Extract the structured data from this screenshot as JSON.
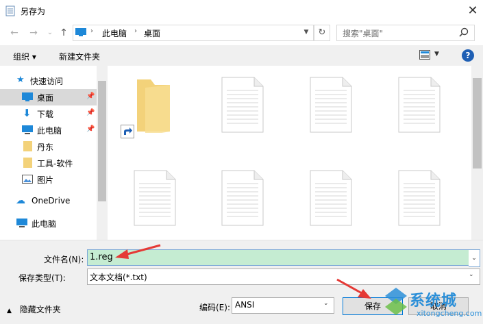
{
  "window": {
    "title": "另存为",
    "close_glyph": "✕"
  },
  "nav": {
    "back_glyph": "←",
    "forward_glyph": "→",
    "recent_glyph": "⌄",
    "up_glyph": "↑",
    "breadcrumb": [
      "此电脑",
      "桌面"
    ],
    "search_placeholder": "搜索\"桌面\""
  },
  "toolbar": {
    "organize_label": "组织 ▾",
    "new_folder_label": "新建文件夹",
    "help_label": "?"
  },
  "sidebar": {
    "items": [
      {
        "label": "快速访问",
        "icon": "star-icon"
      },
      {
        "label": "桌面",
        "icon": "desktop-icon",
        "pinned": true,
        "selected": true
      },
      {
        "label": "下载",
        "icon": "download-icon",
        "pinned": true
      },
      {
        "label": "此电脑",
        "icon": "computer-icon",
        "pinned": true
      },
      {
        "label": "丹东",
        "icon": "folder-icon"
      },
      {
        "label": "工具-软件",
        "icon": "folder-icon"
      },
      {
        "label": "图片",
        "icon": "pictures-icon"
      },
      {
        "label": "OneDrive",
        "icon": "cloud-icon"
      },
      {
        "label": "此电脑",
        "icon": "computer-icon"
      }
    ]
  },
  "files": [
    {
      "type": "folder-shortcut"
    },
    {
      "type": "document"
    },
    {
      "type": "document"
    },
    {
      "type": "document"
    },
    {
      "type": "document"
    },
    {
      "type": "document"
    },
    {
      "type": "document"
    },
    {
      "type": "document"
    }
  ],
  "form": {
    "filename_label": "文件名(N):",
    "filename_value": "1.reg",
    "filetype_label": "保存类型(T):",
    "filetype_value": "文本文档(*.txt)",
    "hide_folders_label": "隐藏文件夹",
    "encoding_label": "编码(E):",
    "encoding_value": "ANSI",
    "save_label": "保存",
    "cancel_label": "取消"
  },
  "watermark": {
    "brand": "系统城",
    "url": "xitongcheng.com"
  },
  "colors": {
    "accent": "#0078d7",
    "filename_highlight": "#c5ecd2",
    "folder": "#f3d27a",
    "annotation_arrow": "#e53935"
  }
}
